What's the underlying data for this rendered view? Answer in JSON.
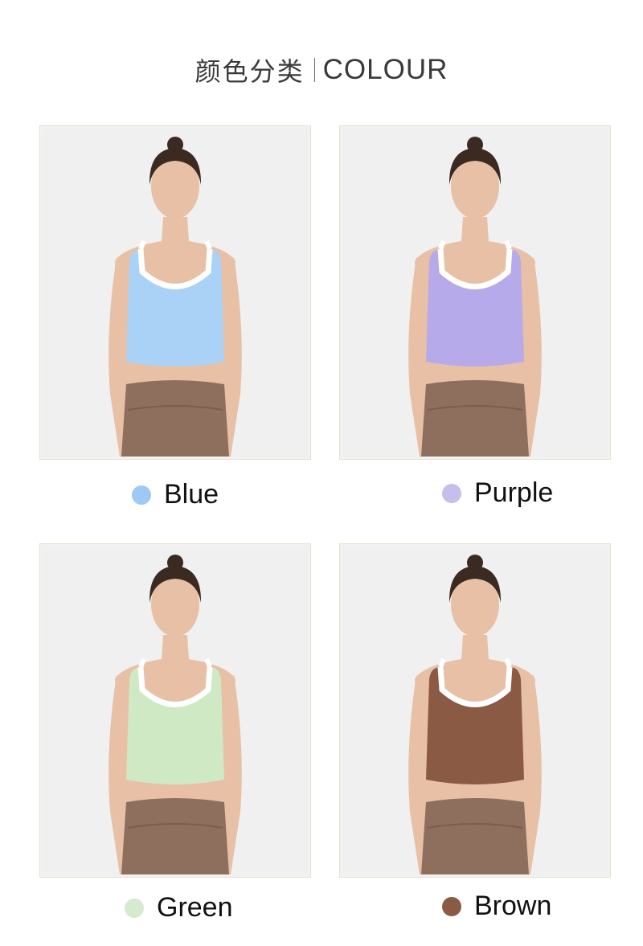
{
  "header": {
    "title_cn": "颜色分类",
    "title_en": "COLOUR"
  },
  "variants": [
    {
      "name": "Blue",
      "color": "#9ec9f2",
      "top_color": "#a9d2f6"
    },
    {
      "name": "Purple",
      "color": "#c6bfee",
      "top_color": "#b7aaea"
    },
    {
      "name": "Green",
      "color": "#d6ead0",
      "top_color": "#cfe9c4"
    },
    {
      "name": "Brown",
      "color": "#8a5a44",
      "top_color": "#8b5a45"
    }
  ],
  "skin_color": "#e7c0a6",
  "pants_color": "#8e6f5e",
  "hair_color": "#3b2a22"
}
